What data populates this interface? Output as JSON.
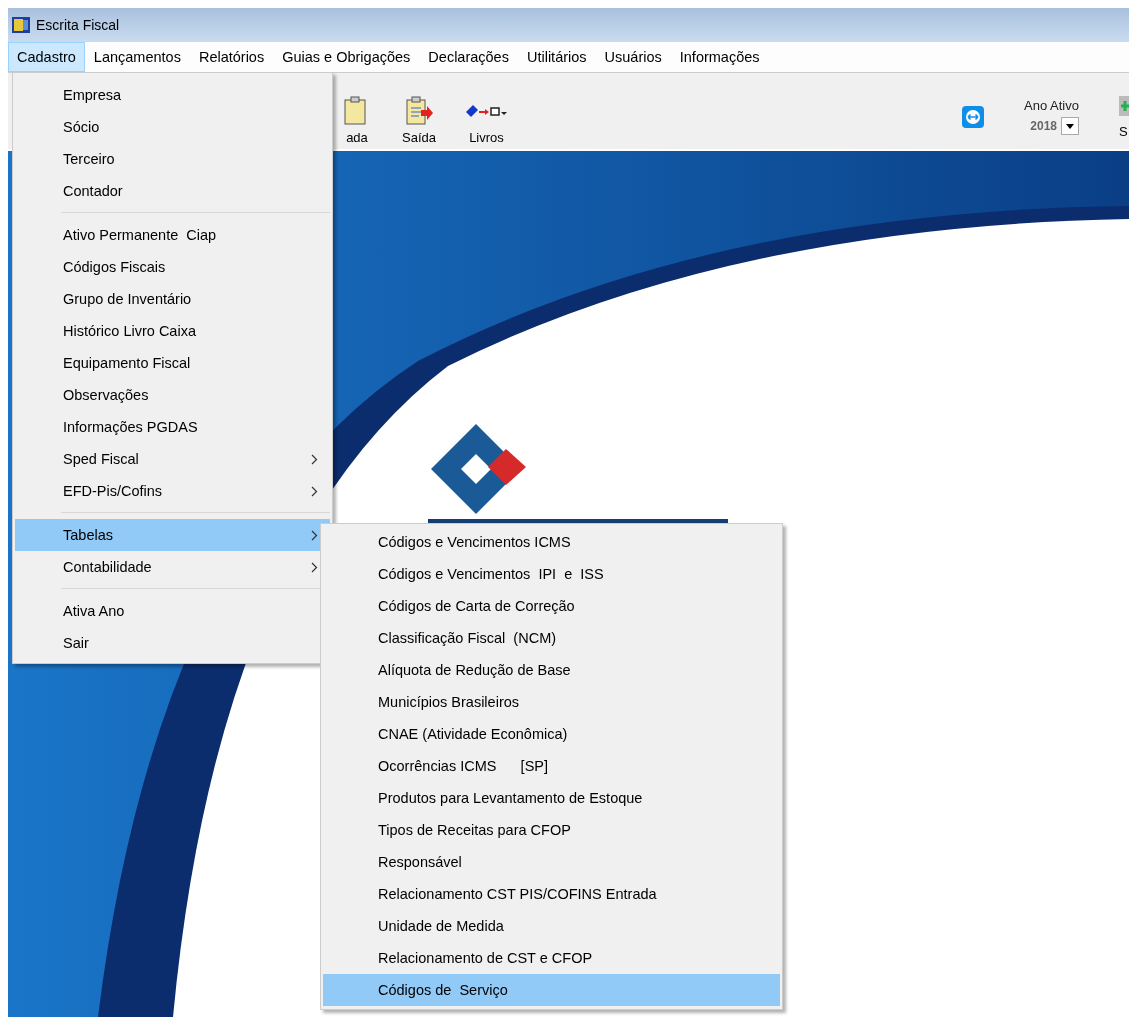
{
  "window": {
    "title": "Escrita Fiscal"
  },
  "menu_bar": [
    {
      "label": "Cadastro",
      "selected": true
    },
    {
      "label": "Lançamentos",
      "selected": false
    },
    {
      "label": "Relatórios",
      "selected": false
    },
    {
      "label": "Guias e Obrigações",
      "selected": false
    },
    {
      "label": "Declarações",
      "selected": false
    },
    {
      "label": "Utilitários",
      "selected": false
    },
    {
      "label": "Usuários",
      "selected": false
    },
    {
      "label": "Informações",
      "selected": false
    }
  ],
  "toolbar": {
    "buttons": [
      {
        "kind": "clipboard-in",
        "label": "ada"
      },
      {
        "kind": "clipboard-out",
        "label": "Saída"
      },
      {
        "kind": "books",
        "label": "Livros"
      }
    ],
    "year_label": "Ano Ativo",
    "year_value": "2018",
    "last_button": "S"
  },
  "dropdown": [
    {
      "kind": "item",
      "label": "Empresa",
      "submenu": false,
      "selected": false
    },
    {
      "kind": "item",
      "label": "Sócio",
      "submenu": false,
      "selected": false
    },
    {
      "kind": "item",
      "label": "Terceiro",
      "submenu": false,
      "selected": false
    },
    {
      "kind": "item",
      "label": "Contador",
      "submenu": false,
      "selected": false
    },
    {
      "kind": "separator"
    },
    {
      "kind": "item",
      "label": "Ativo Permanente  Ciap",
      "submenu": false,
      "selected": false
    },
    {
      "kind": "item",
      "label": "Códigos Fiscais",
      "submenu": false,
      "selected": false
    },
    {
      "kind": "item",
      "label": "Grupo de Inventário",
      "submenu": false,
      "selected": false
    },
    {
      "kind": "item",
      "label": "Histórico Livro Caixa",
      "submenu": false,
      "selected": false
    },
    {
      "kind": "item",
      "label": "Equipamento Fiscal",
      "submenu": false,
      "selected": false
    },
    {
      "kind": "item",
      "label": "Observações",
      "submenu": false,
      "selected": false
    },
    {
      "kind": "item",
      "label": "Informações PGDAS",
      "submenu": false,
      "selected": false
    },
    {
      "kind": "item",
      "label": "Sped Fiscal",
      "submenu": true,
      "selected": false
    },
    {
      "kind": "item",
      "label": "EFD-Pis/Cofins",
      "submenu": true,
      "selected": false
    },
    {
      "kind": "separator"
    },
    {
      "kind": "item",
      "label": "Tabelas",
      "submenu": true,
      "selected": true
    },
    {
      "kind": "item",
      "label": "Contabilidade",
      "submenu": true,
      "selected": false
    },
    {
      "kind": "separator"
    },
    {
      "kind": "item",
      "label": "Ativa Ano",
      "submenu": false,
      "selected": false
    },
    {
      "kind": "item",
      "label": "Sair",
      "submenu": false,
      "selected": false
    }
  ],
  "submenu": [
    {
      "label": "Códigos e Vencimentos ICMS",
      "selected": false
    },
    {
      "label": "Códigos e Vencimentos  IPI  e  ISS",
      "selected": false
    },
    {
      "label": "Códigos de Carta de Correção",
      "selected": false
    },
    {
      "label": "Classificação Fiscal  (NCM)",
      "selected": false
    },
    {
      "label": "Alíquota de Redução de Base",
      "selected": false
    },
    {
      "label": "Municípios Brasileiros",
      "selected": false
    },
    {
      "label": "CNAE (Atividade Econômica)",
      "selected": false
    },
    {
      "label": "Ocorrências ICMS      [SP]",
      "selected": false
    },
    {
      "label": "Produtos para Levantamento de Estoque",
      "selected": false
    },
    {
      "label": "Tipos de Receitas para CFOP",
      "selected": false
    },
    {
      "label": "Responsável",
      "selected": false
    },
    {
      "label": "Relacionamento CST PIS/COFINS Entrada",
      "selected": false
    },
    {
      "label": "Unidade de Medida",
      "selected": false
    },
    {
      "label": "Relacionamento de CST e CFOP",
      "selected": false
    },
    {
      "label": "Códigos de  Serviço",
      "selected": true
    }
  ]
}
